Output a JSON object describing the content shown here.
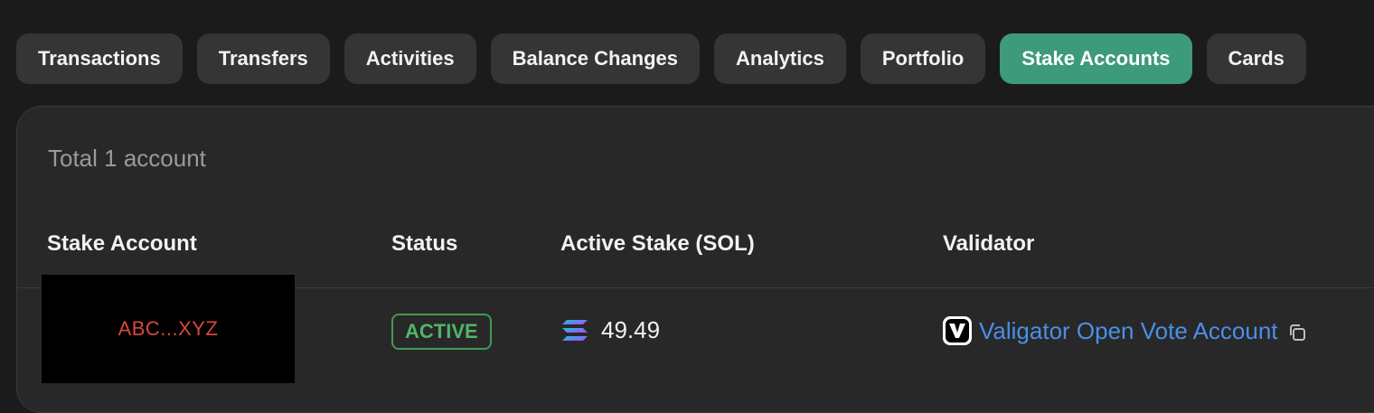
{
  "tabs": [
    {
      "label": "Transactions",
      "active": false
    },
    {
      "label": "Transfers",
      "active": false
    },
    {
      "label": "Activities",
      "active": false
    },
    {
      "label": "Balance Changes",
      "active": false
    },
    {
      "label": "Analytics",
      "active": false
    },
    {
      "label": "Portfolio",
      "active": false
    },
    {
      "label": "Stake Accounts",
      "active": true
    },
    {
      "label": "Cards",
      "active": false
    }
  ],
  "summary": {
    "total_text": "Total 1 account"
  },
  "table": {
    "headers": {
      "stake_account": "Stake Account",
      "status": "Status",
      "active_stake": "Active Stake (SOL)",
      "validator": "Validator"
    },
    "rows": [
      {
        "stake_account": "ABC...XYZ",
        "status": "ACTIVE",
        "active_stake": "49.49",
        "validator_name": "Valigator Open Vote Account",
        "token_icon": "solana-icon",
        "validator_icon": "valigator-logo-icon"
      }
    ]
  },
  "colors": {
    "accent": "#3d9a7a",
    "status_active": "#4fb56a",
    "link": "#4a8fe8",
    "account_text": "#d9473b"
  }
}
